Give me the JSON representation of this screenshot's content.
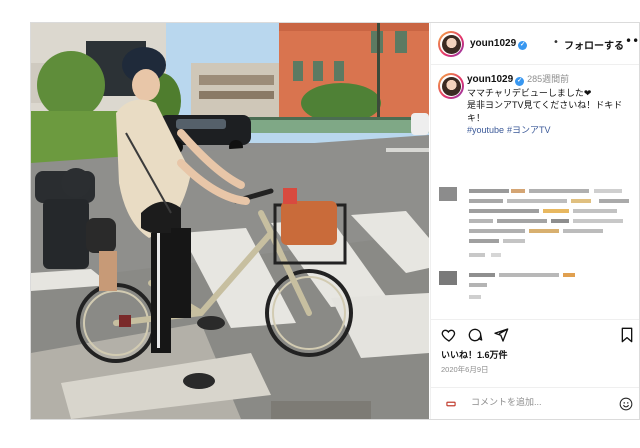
{
  "post": {
    "username": "youn1029",
    "follow_label": "フォローする",
    "separator": "•",
    "more_label": "•••",
    "caption": {
      "username": "youn1029",
      "time": "285週間前",
      "line1": "ママチャリデビューしました❤",
      "line2": "是非ヨンアTV見てくださいね！ドキド",
      "line3": "キ！",
      "hashtags": [
        "#youtube",
        "#ヨンアTV"
      ]
    },
    "likes": "いいね！1.6万件",
    "date": "2020年6月9日",
    "comment_placeholder": "コメントを追加..."
  },
  "icons": {
    "verified": "verified-badge-icon",
    "more": "more-options-icon",
    "like": "heart-icon",
    "comment": "comment-icon",
    "share": "paper-plane-icon",
    "save": "bookmark-icon",
    "emoji": "emoji-icon"
  },
  "colors": {
    "verified": "#3897f0",
    "hashtag": "#3b5998",
    "muted": "#8e8e8e",
    "border": "#dbdbdb"
  }
}
